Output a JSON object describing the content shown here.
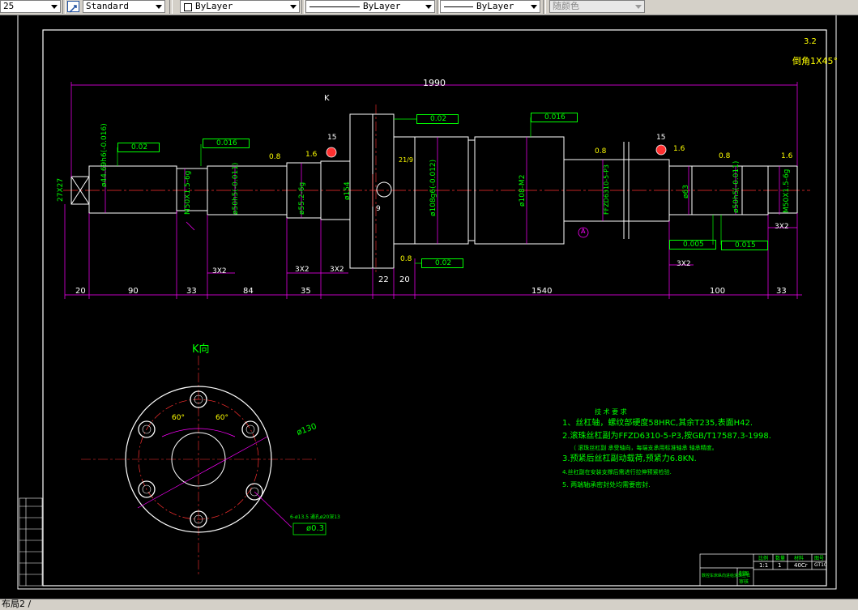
{
  "toolbar": {
    "scale_value": "25",
    "text_style": "Standard",
    "layer": "ByLayer",
    "linetype": "ByLayer",
    "lineweight": "ByLayer",
    "plot_style": "随颜色"
  },
  "drawing": {
    "overall_length": "1990",
    "view_arrow": "K",
    "roughness_top": "3.2",
    "chamfer_note": "倒角1X45°",
    "tolerances": [
      "0.02",
      "0.016",
      "0.02",
      "0.016",
      "0.005",
      "0.015",
      "0.02",
      "0.3"
    ],
    "datum": "A",
    "diameters": {
      "d1": "ø44.69h6(-0.016)",
      "d2": "M50X1.5-6g",
      "d3": "ø50h5(-0.011)",
      "d4": "ø55.2-6g",
      "d5": "ø154",
      "d6": "ø108g6(-0.012)",
      "d7": "ø108-M2",
      "d8": "FFZD6310-5-P3",
      "d9": "ø63",
      "d10": "ø50h5(-0.011)",
      "d11": "M50X1.5-6g",
      "end_square": "27X27"
    },
    "roughness_marks": [
      "0.8",
      "1.6",
      "0.8",
      "1.6",
      "0.8",
      "0.8",
      "1.6"
    ],
    "angle_mark": "21/9",
    "small_dims": [
      "9",
      "15",
      "15"
    ],
    "grooves": [
      "3X2",
      "3X2",
      "3X2",
      "3X2",
      "3X2"
    ],
    "bottom_dims": [
      "20",
      "90",
      "33",
      "84",
      "35",
      "22",
      "20",
      "1540",
      "100",
      "33"
    ],
    "k_view": {
      "title": "K向",
      "angle_left": "60°",
      "angle_right": "60°",
      "pcd": "ø130",
      "holes_note": "6-ø13.5 通孔ø20深13",
      "hole_tol": "ø0.3"
    },
    "notes": {
      "title": "技 术 要 求",
      "items": [
        "1、丝杠轴，螺纹部硬度58HRC,其余T235,表面H42.",
        "2.滚珠丝杠副为FFZD6310-5-P3,按GB/T17587.3-1998.",
        "（ 滚珠丝杠副  承受轴向，每端支承用标准轴承      轴承精度。",
        "3.预紧后丝杠副动载荷,预紧力6.8KN.",
        "4.丝杠副在安装支撑后需进行拉伸预紧检验.",
        "5.      两端轴承密封处均需要密封."
      ]
    },
    "title_block": {
      "drawing_title": "数控车床纵向进给滚珠丝杠",
      "cells": [
        "比例",
        "数量",
        "材料",
        "图号",
        "1:1",
        "1",
        "40Cr",
        "GT10",
        "制图",
        "审核"
      ]
    }
  }
}
